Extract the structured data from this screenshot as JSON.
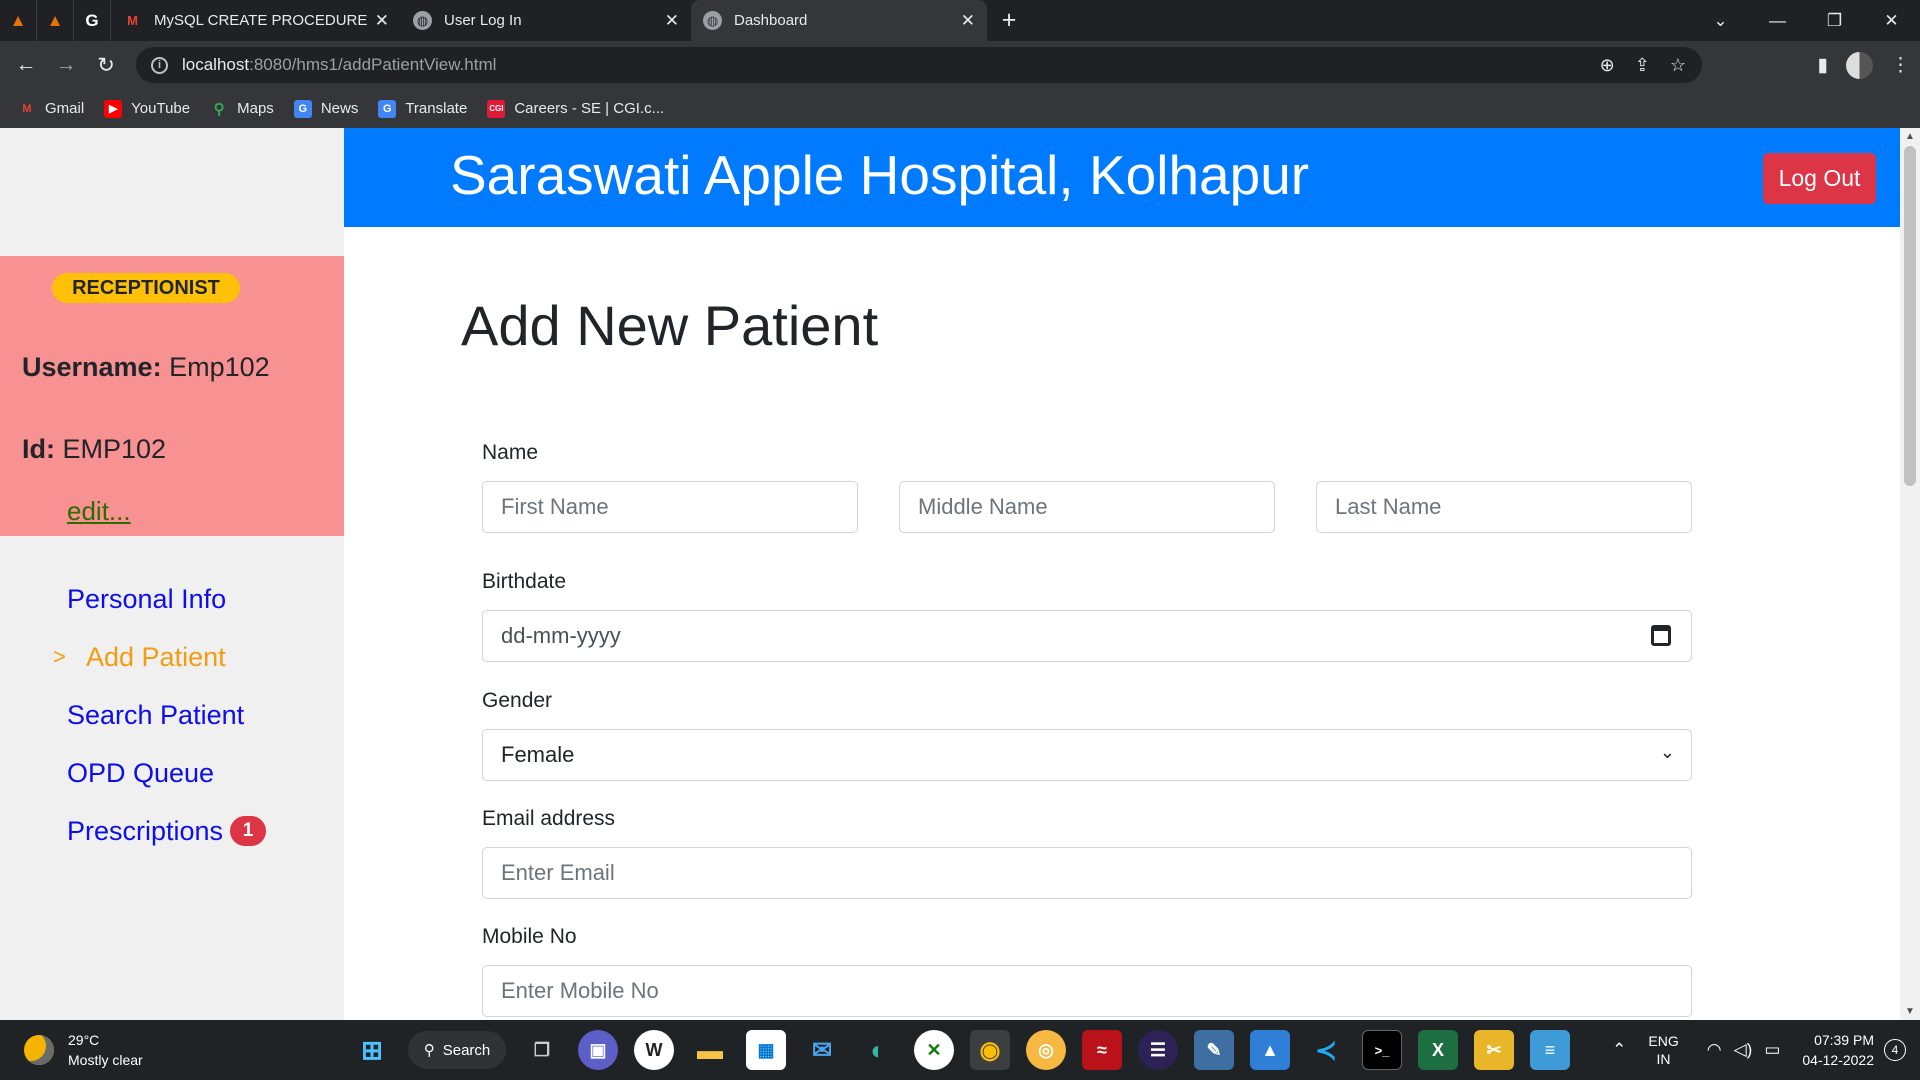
{
  "browser": {
    "tabs": [
      {
        "title": "MySQL CREATE PROCEDURE By P",
        "favicon": "gmail-like-icon",
        "active": false
      },
      {
        "title": "User Log In",
        "favicon": "globe-icon",
        "active": false
      },
      {
        "title": "Dashboard",
        "favicon": "globe-icon",
        "active": true
      }
    ],
    "url_host": "localhost",
    "url_path": ":8080/hms1/addPatientView.html",
    "bookmarks": [
      {
        "label": "Gmail",
        "icon": "gmail-icon",
        "color": "#ea4335"
      },
      {
        "label": "YouTube",
        "icon": "youtube-icon",
        "color": "#ff0000"
      },
      {
        "label": "Maps",
        "icon": "maps-icon",
        "color": "#34a853"
      },
      {
        "label": "News",
        "icon": "news-icon",
        "color": "#4285f4"
      },
      {
        "label": "Translate",
        "icon": "translate-icon",
        "color": "#4285f4"
      },
      {
        "label": "Careers - SE | CGI.c...",
        "icon": "cgi-icon",
        "color": "#e11937"
      }
    ]
  },
  "app": {
    "hospital_name": "Saraswati Apple Hospital, Kolhapur",
    "logout_label": "Log Out",
    "role": "RECEPTIONIST",
    "username_label": "Username:",
    "username_value": "Emp102",
    "id_label": "Id:",
    "id_value": "EMP102",
    "edit_label": "edit...",
    "nav": [
      {
        "label": "Personal Info",
        "active": false
      },
      {
        "label": "Add Patient",
        "active": true,
        "caret": ">"
      },
      {
        "label": "Search Patient",
        "active": false
      },
      {
        "label": "OPD Queue",
        "active": false
      },
      {
        "label": "Prescriptions",
        "active": false,
        "badge": "1"
      }
    ]
  },
  "form": {
    "heading": "Add New Patient",
    "name_label": "Name",
    "first_name_placeholder": "First Name",
    "middle_name_placeholder": "Middle Name",
    "last_name_placeholder": "Last Name",
    "birthdate_label": "Birthdate",
    "birthdate_placeholder": "dd-mm-yyyy",
    "gender_label": "Gender",
    "gender_value": "Female",
    "email_label": "Email address",
    "email_placeholder": "Enter Email",
    "mobile_label": "Mobile No",
    "mobile_placeholder": "Enter Mobile No"
  },
  "taskbar": {
    "weather_temp": "29°C",
    "weather_desc": "Mostly clear",
    "search_label": "Search",
    "lang_top": "ENG",
    "lang_bottom": "IN",
    "time": "07:39 PM",
    "date": "04-12-2022",
    "notif_count": "4"
  },
  "colors": {
    "banner": "#007bff",
    "sidebar_profile": "#f89191",
    "role_badge": "#ffc107",
    "logout": "#dc3545",
    "nav_link": "#0d0ded",
    "nav_active": "#f39c12"
  }
}
